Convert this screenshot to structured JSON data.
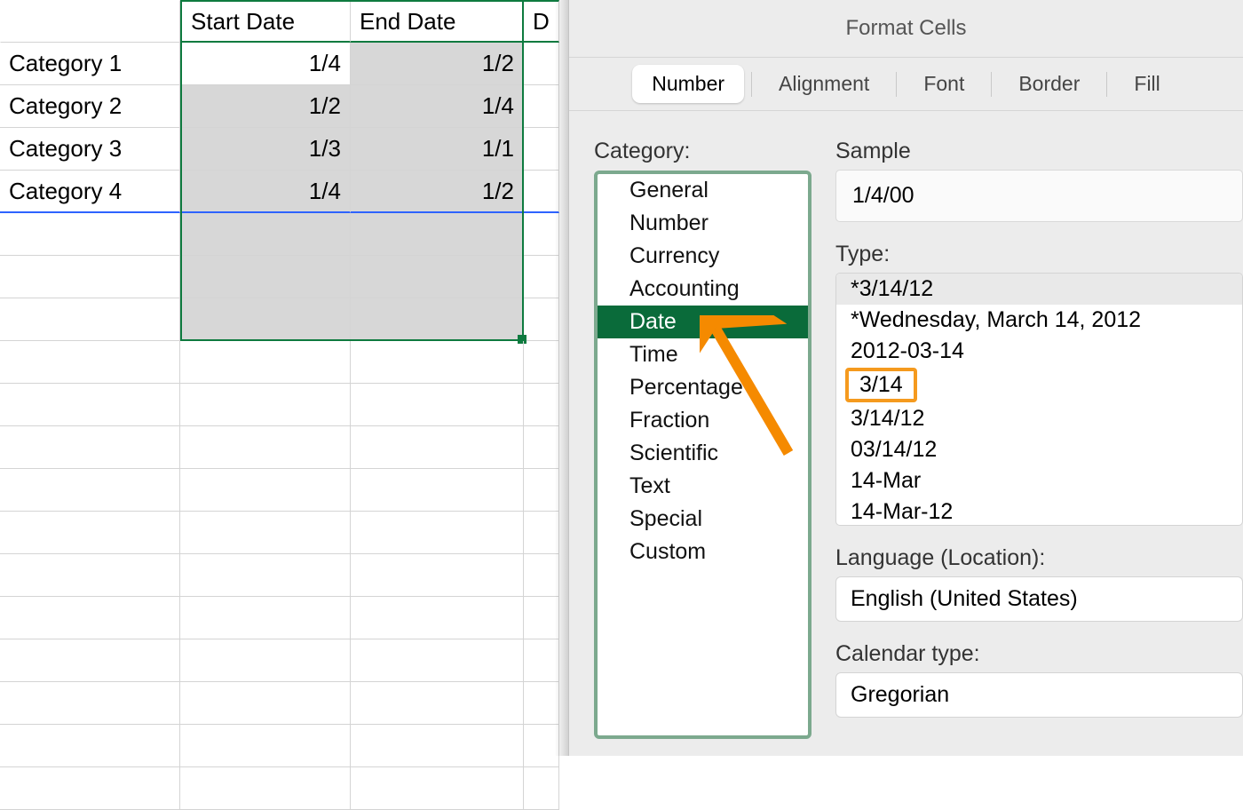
{
  "spreadsheet": {
    "headers": [
      "",
      "Start Date",
      "End Date",
      "D"
    ],
    "rows": [
      {
        "label": "Category 1",
        "start": "1/4",
        "end": "1/2"
      },
      {
        "label": "Category 2",
        "start": "1/2",
        "end": "1/4"
      },
      {
        "label": "Category 3",
        "start": "1/3",
        "end": "1/1"
      },
      {
        "label": "Category 4",
        "start": "1/4",
        "end": "1/2"
      }
    ]
  },
  "dialog": {
    "title": "Format Cells",
    "tabs": [
      "Number",
      "Alignment",
      "Font",
      "Border",
      "Fill"
    ],
    "active_tab": "Number",
    "category_label": "Category:",
    "categories": [
      "General",
      "Number",
      "Currency",
      "Accounting",
      "Date",
      "Time",
      "Percentage",
      "Fraction",
      "Scientific",
      "Text",
      "Special",
      "Custom"
    ],
    "selected_category": "Date",
    "sample_label": "Sample",
    "sample_value": "1/4/00",
    "type_label": "Type:",
    "types": [
      "*3/14/12",
      "*Wednesday, March 14, 2012",
      "2012-03-14",
      "3/14",
      "3/14/12",
      "03/14/12",
      "14-Mar",
      "14-Mar-12"
    ],
    "highlighted_type": "*3/14/12",
    "boxed_type": "3/14",
    "language_label": "Language (Location):",
    "language_value": "English (United States)",
    "calendar_label": "Calendar type:",
    "calendar_value": "Gregorian"
  }
}
